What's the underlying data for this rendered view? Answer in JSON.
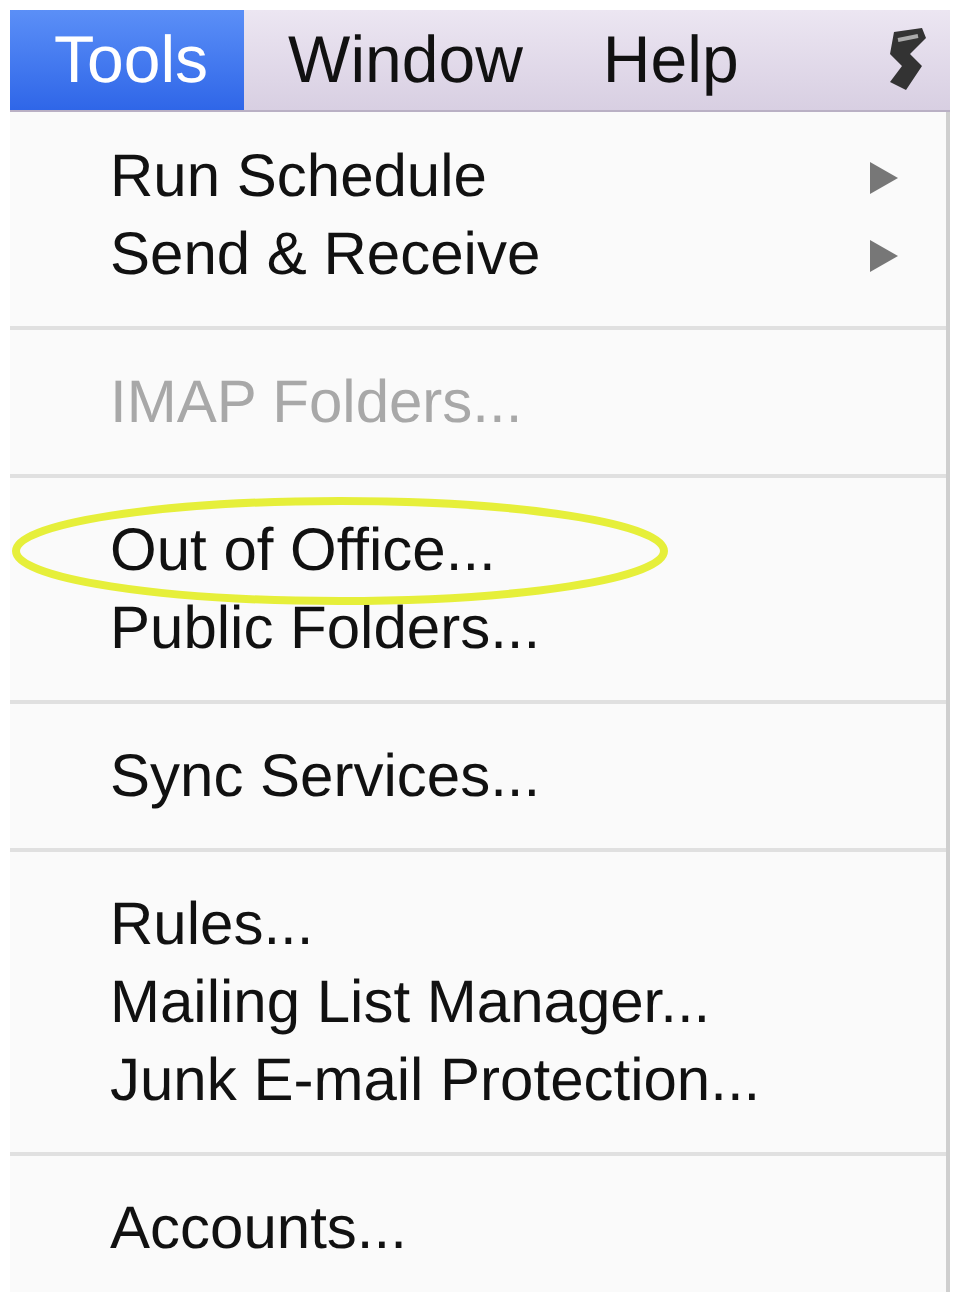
{
  "menu_bar": {
    "items": [
      {
        "label": "Tools",
        "selected": true
      },
      {
        "label": "Window",
        "selected": false
      },
      {
        "label": "Help",
        "selected": false
      }
    ]
  },
  "menu": {
    "groups": [
      {
        "items": [
          {
            "label": "Run Schedule",
            "disabled": false,
            "submenu": true,
            "circled": false
          },
          {
            "label": "Send & Receive",
            "disabled": false,
            "submenu": true,
            "circled": false
          }
        ]
      },
      {
        "items": [
          {
            "label": "IMAP Folders...",
            "disabled": true,
            "submenu": false,
            "circled": false
          }
        ]
      },
      {
        "items": [
          {
            "label": "Out of Office...",
            "disabled": false,
            "submenu": false,
            "circled": true
          },
          {
            "label": "Public Folders...",
            "disabled": false,
            "submenu": false,
            "circled": false
          }
        ]
      },
      {
        "items": [
          {
            "label": "Sync Services...",
            "disabled": false,
            "submenu": false,
            "circled": false
          }
        ]
      },
      {
        "items": [
          {
            "label": "Rules...",
            "disabled": false,
            "submenu": false,
            "circled": false
          },
          {
            "label": "Mailing List Manager...",
            "disabled": false,
            "submenu": false,
            "circled": false
          },
          {
            "label": "Junk E-mail Protection...",
            "disabled": false,
            "submenu": false,
            "circled": false
          }
        ]
      },
      {
        "items": [
          {
            "label": "Accounts...",
            "disabled": false,
            "submenu": false,
            "circled": false
          }
        ]
      }
    ]
  }
}
